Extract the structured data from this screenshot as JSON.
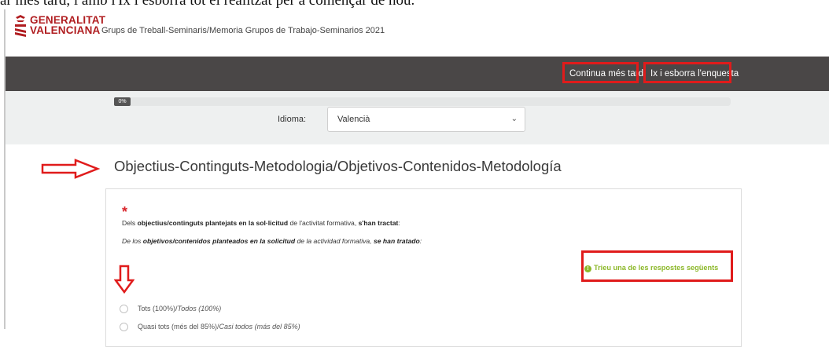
{
  "doc_fragment": "ar més tard, i amb l'Ix i esborra tot el realitzat per a començar de nou.",
  "header": {
    "logo_line1": "GENERALITAT",
    "logo_line2": "VALENCIANA",
    "breadcrumb": "Grups de Treball-Seminaris/Memoria Grupos de Trabajo-Seminarios 2021"
  },
  "navbar": {
    "continue_label": "Continua més tard",
    "exit_label": "Ix i esborra l'enquesta"
  },
  "progress": {
    "percent_label": "0%",
    "value": 0
  },
  "language": {
    "label": "Idioma:",
    "selected": "Valencià"
  },
  "group": {
    "title": "Objectius-Continguts-Metodologia/Objetivos-Contenidos-Metodología"
  },
  "question": {
    "required_mark": "*",
    "line1_a": "Dels ",
    "line1_b": "objectius/continguts plantejats en la sol·licitud",
    "line1_c": " de l'activitat formativa, ",
    "line1_d": "s'han tractat",
    "line1_e": ":",
    "line2_a": "De los ",
    "line2_b": "objetivos/contenidos planteados en la solicitud",
    "line2_c": " de la actividad formativa, ",
    "line2_d": "se han tratado",
    "line2_e": ":",
    "tip_text": "Trieu una de les respostes següents",
    "options": [
      {
        "label": "Tots (100%)/",
        "label_it": "Todos (100%)"
      },
      {
        "label": "Quasi tots (més del 85%)/",
        "label_it": "Casi todos (más del 85%)"
      }
    ]
  },
  "annotation_colors": {
    "highlight": "#e01b1b",
    "accent_green": "#8cb82a",
    "navbar_bg": "#4a4747",
    "brand_red": "#b01d20"
  }
}
